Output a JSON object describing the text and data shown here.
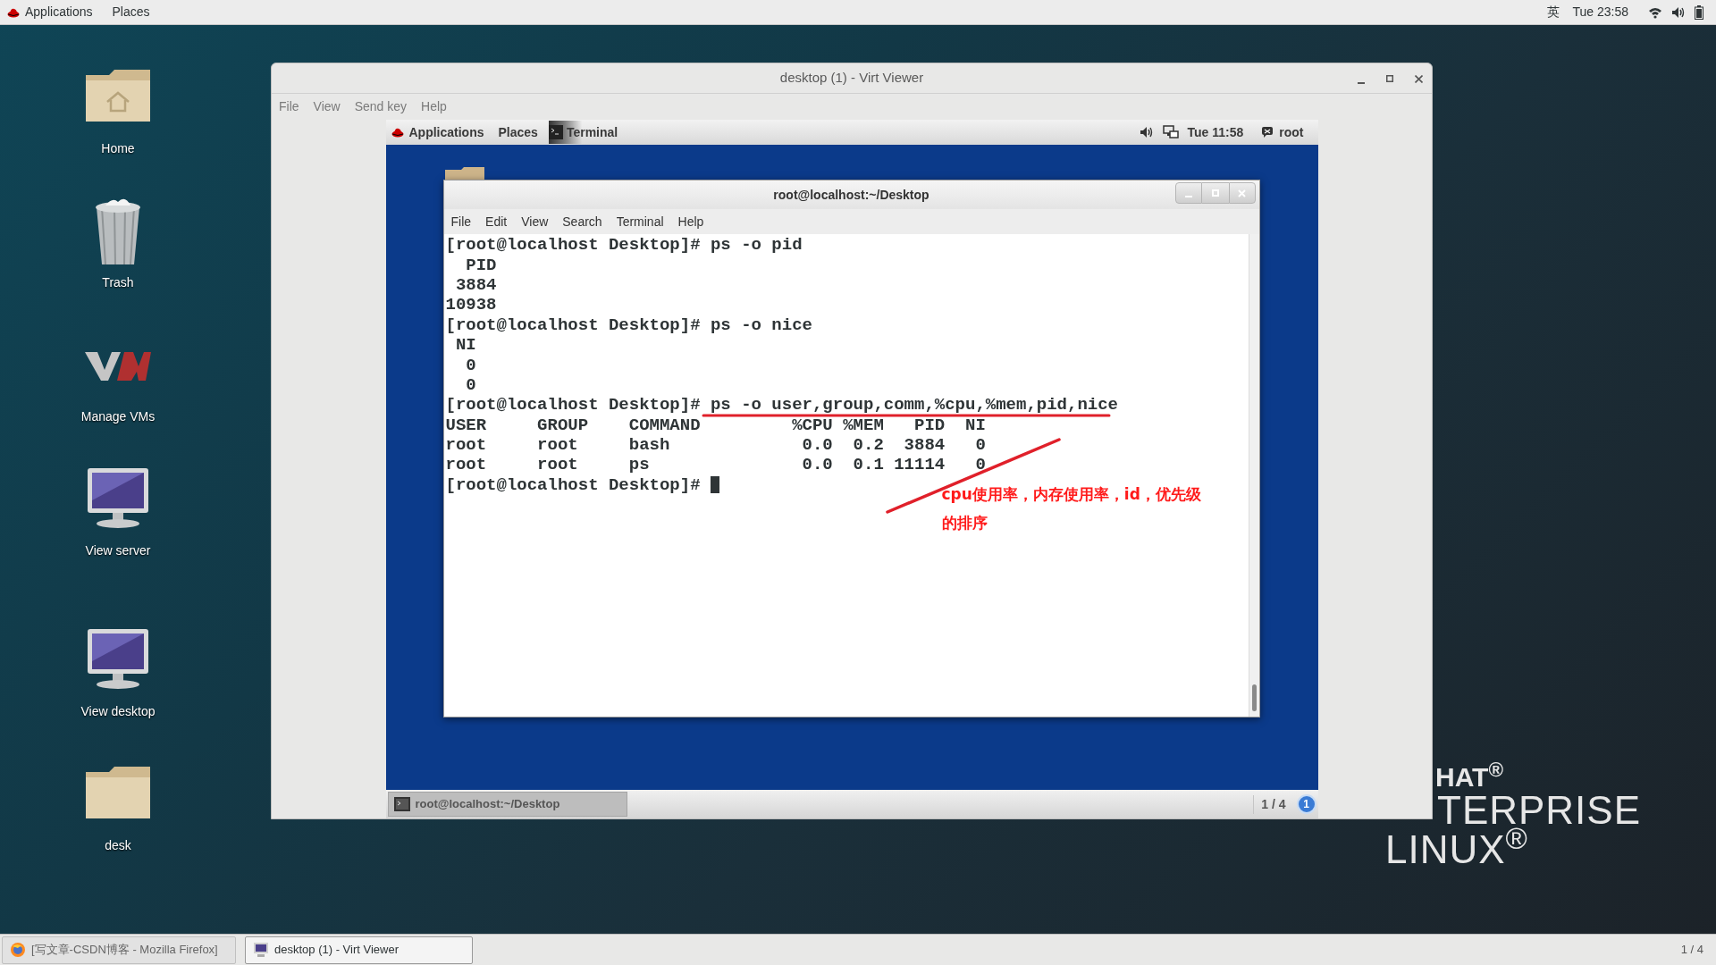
{
  "top_bar": {
    "menus": [
      "Applications",
      "Places"
    ],
    "input_method": "英",
    "clock": "Tue 23:58"
  },
  "desktop_icons": [
    {
      "label": "Home",
      "kind": "home"
    },
    {
      "label": "Trash",
      "kind": "trash"
    },
    {
      "label": "Manage VMs",
      "kind": "vm"
    },
    {
      "label": "View server",
      "kind": "monitor"
    },
    {
      "label": "View desktop",
      "kind": "monitor"
    },
    {
      "label": "desk",
      "kind": "folder"
    }
  ],
  "wallpaper_logo": {
    "line_1": "HAT$^{®}$",
    "line_2": "TERPRISE",
    "line_3": "LINUX$^{®}$"
  },
  "viewer_window": {
    "title": "desktop (1) - Virt Viewer",
    "menu": [
      "File",
      "View",
      "Send key",
      "Help"
    ],
    "guest": {
      "top_bar": {
        "menus": [
          "Applications",
          "Places"
        ],
        "task": "Terminal",
        "clock": "Tue 11:58",
        "user": "root"
      },
      "terminal": {
        "title": "root@localhost:~/Desktop",
        "menu": [
          "File",
          "Edit",
          "View",
          "Search",
          "Terminal",
          "Help"
        ],
        "lines": [
          {
            "text": "[root@localhost Desktop]# ps -o pid",
            "cursor": false
          },
          {
            "text": "  PID",
            "cursor": false
          },
          {
            "text": " 3884",
            "cursor": false
          },
          {
            "text": "10938",
            "cursor": false
          },
          {
            "text": "[root@localhost Desktop]# ps -o nice",
            "cursor": false
          },
          {
            "text": " NI",
            "cursor": false
          },
          {
            "text": "  0",
            "cursor": false
          },
          {
            "text": "  0",
            "cursor": false
          },
          {
            "text": "[root@localhost Desktop]# ps -o user,group,comm,%cpu,%mem,pid,nice",
            "cursor": false
          },
          {
            "text": "USER     GROUP    COMMAND         %CPU %MEM   PID  NI",
            "cursor": false
          },
          {
            "text": "root     root     bash             0.0  0.2  3884   0",
            "cursor": false
          },
          {
            "text": "root     root     ps               0.0  0.1 11114   0",
            "cursor": false
          },
          {
            "text": "[root@localhost Desktop]# ",
            "cursor": true
          }
        ],
        "annotation": "cpu使用率，内存使用率，id，优先级的排序"
      },
      "bottom_bar": {
        "task": "root@localhost:~/Desktop",
        "workspace": "1 / 4",
        "notification_count": "1"
      }
    }
  },
  "taskbar": {
    "items": [
      {
        "label": "[写文章-CSDN博客 - Mozilla Firefox]",
        "kind": "browser",
        "selected": false
      },
      {
        "label": "desktop (1) - Virt Viewer",
        "kind": "viewer",
        "selected": true
      }
    ],
    "workspace": "1 / 4"
  }
}
